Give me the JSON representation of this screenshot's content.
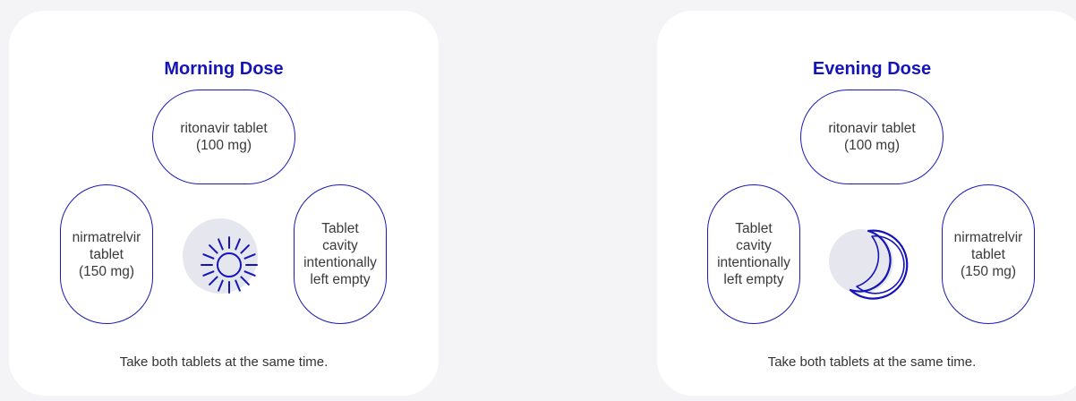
{
  "colors": {
    "page_background": "#f4f4f7",
    "card_background": "#ffffff",
    "accent_blue": "#1414b8",
    "icon_circle": "#e6e7ee",
    "text": "#333333"
  },
  "morning": {
    "title": "Morning Dose",
    "top_tablet": "ritonavir tablet\n(100 mg)",
    "left_tablet": "nirmatrelvir\ntablet\n(150 mg)",
    "right_tablet": "Tablet\ncavity\nintentionally\nleft empty",
    "icon": "sun-icon",
    "caption": "Take both tablets at the same time."
  },
  "evening": {
    "title": "Evening Dose",
    "top_tablet": "ritonavir tablet\n(100 mg)",
    "left_tablet": "Tablet\ncavity\nintentionally\nleft empty",
    "right_tablet": "nirmatrelvir\ntablet\n(150 mg)",
    "icon": "moon-icon",
    "caption": "Take both tablets at the same time."
  }
}
